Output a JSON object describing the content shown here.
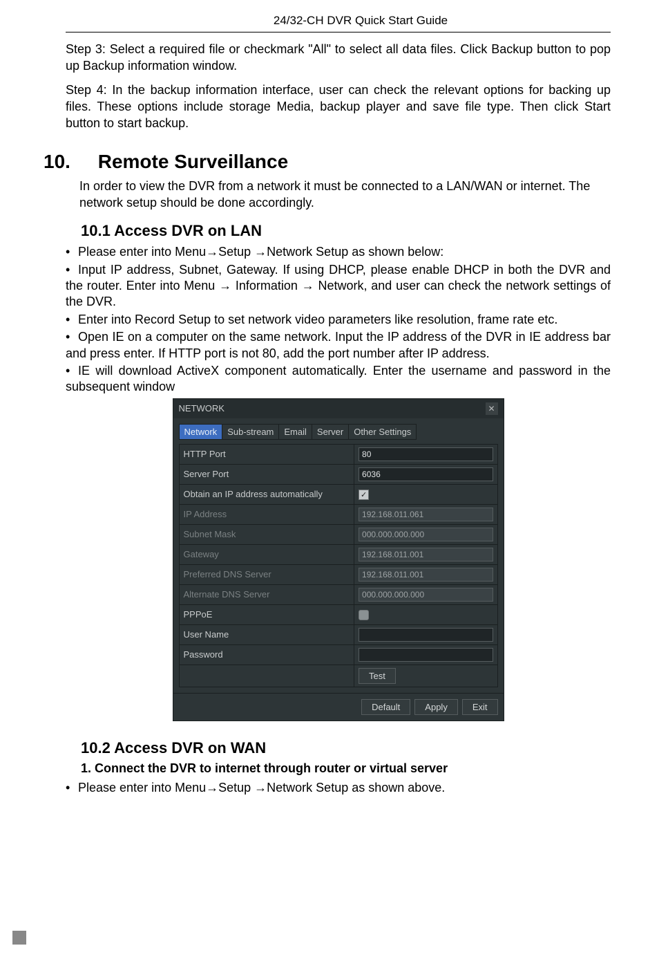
{
  "header": {
    "title": "24/32-CH DVR Quick Start Guide"
  },
  "paragraphs": {
    "step3": "Step 3: Select a required file or checkmark \"All\" to select all data files. Click Backup button to pop up Backup information window.",
    "step4": "Step 4: In the backup information interface, user can check the relevant options for backing up files. These options include storage Media, backup player and save file type. Then click Start button to start backup."
  },
  "section10": {
    "num": "10.",
    "title": "Remote Surveillance",
    "intro": "In order to view the DVR from a network it must be connected to a LAN/WAN or internet. The network setup should be done accordingly."
  },
  "section10_1": {
    "heading": "10.1  Access DVR on LAN",
    "b1": "Please enter into Menu→Setup →Network Setup as shown below:",
    "b2": "Input IP address, Subnet, Gateway. If using DHCP, please enable DHCP in both the DVR and the router. Enter into    Menu → Information → Network, and user can check the network settings of the DVR.",
    "b3": "Enter into Record Setup to set network video parameters like resolution, frame rate etc.",
    "b4": "Open IE on a computer on the same network. Input the IP address of the DVR in IE address bar and press enter. If HTTP port is not 80, add the port number after IP address.",
    "b5": "IE will download ActiveX component automatically. Enter the username and password in the subsequent window"
  },
  "dialog": {
    "title": "NETWORK",
    "tabs": [
      "Network",
      "Sub-stream",
      "Email",
      "Server",
      "Other Settings"
    ],
    "rows": {
      "http_port": {
        "label": "HTTP Port",
        "value": "80"
      },
      "server_port": {
        "label": "Server Port",
        "value": "6036"
      },
      "obtain_auto": {
        "label": "Obtain an IP address automatically",
        "checked": true
      },
      "ip_address": {
        "label": "IP Address",
        "value": "192.168.011.061"
      },
      "subnet_mask": {
        "label": "Subnet Mask",
        "value": "000.000.000.000"
      },
      "gateway": {
        "label": "Gateway",
        "value": "192.168.011.001"
      },
      "pref_dns": {
        "label": "Preferred DNS Server",
        "value": "192.168.011.001"
      },
      "alt_dns": {
        "label": "Alternate DNS Server",
        "value": "000.000.000.000"
      },
      "pppoe": {
        "label": "PPPoE",
        "checked": false
      },
      "user_name": {
        "label": "User Name",
        "value": ""
      },
      "password": {
        "label": "Password",
        "value": ""
      }
    },
    "test_btn": "Test",
    "footer": {
      "default": "Default",
      "apply": "Apply",
      "exit": "Exit"
    }
  },
  "section10_2": {
    "heading": "10.2  Access DVR on WAN",
    "sub1": "1. Connect the DVR to internet through router or virtual server",
    "b1": "Please enter into Menu→Setup →Network Setup as shown above."
  }
}
